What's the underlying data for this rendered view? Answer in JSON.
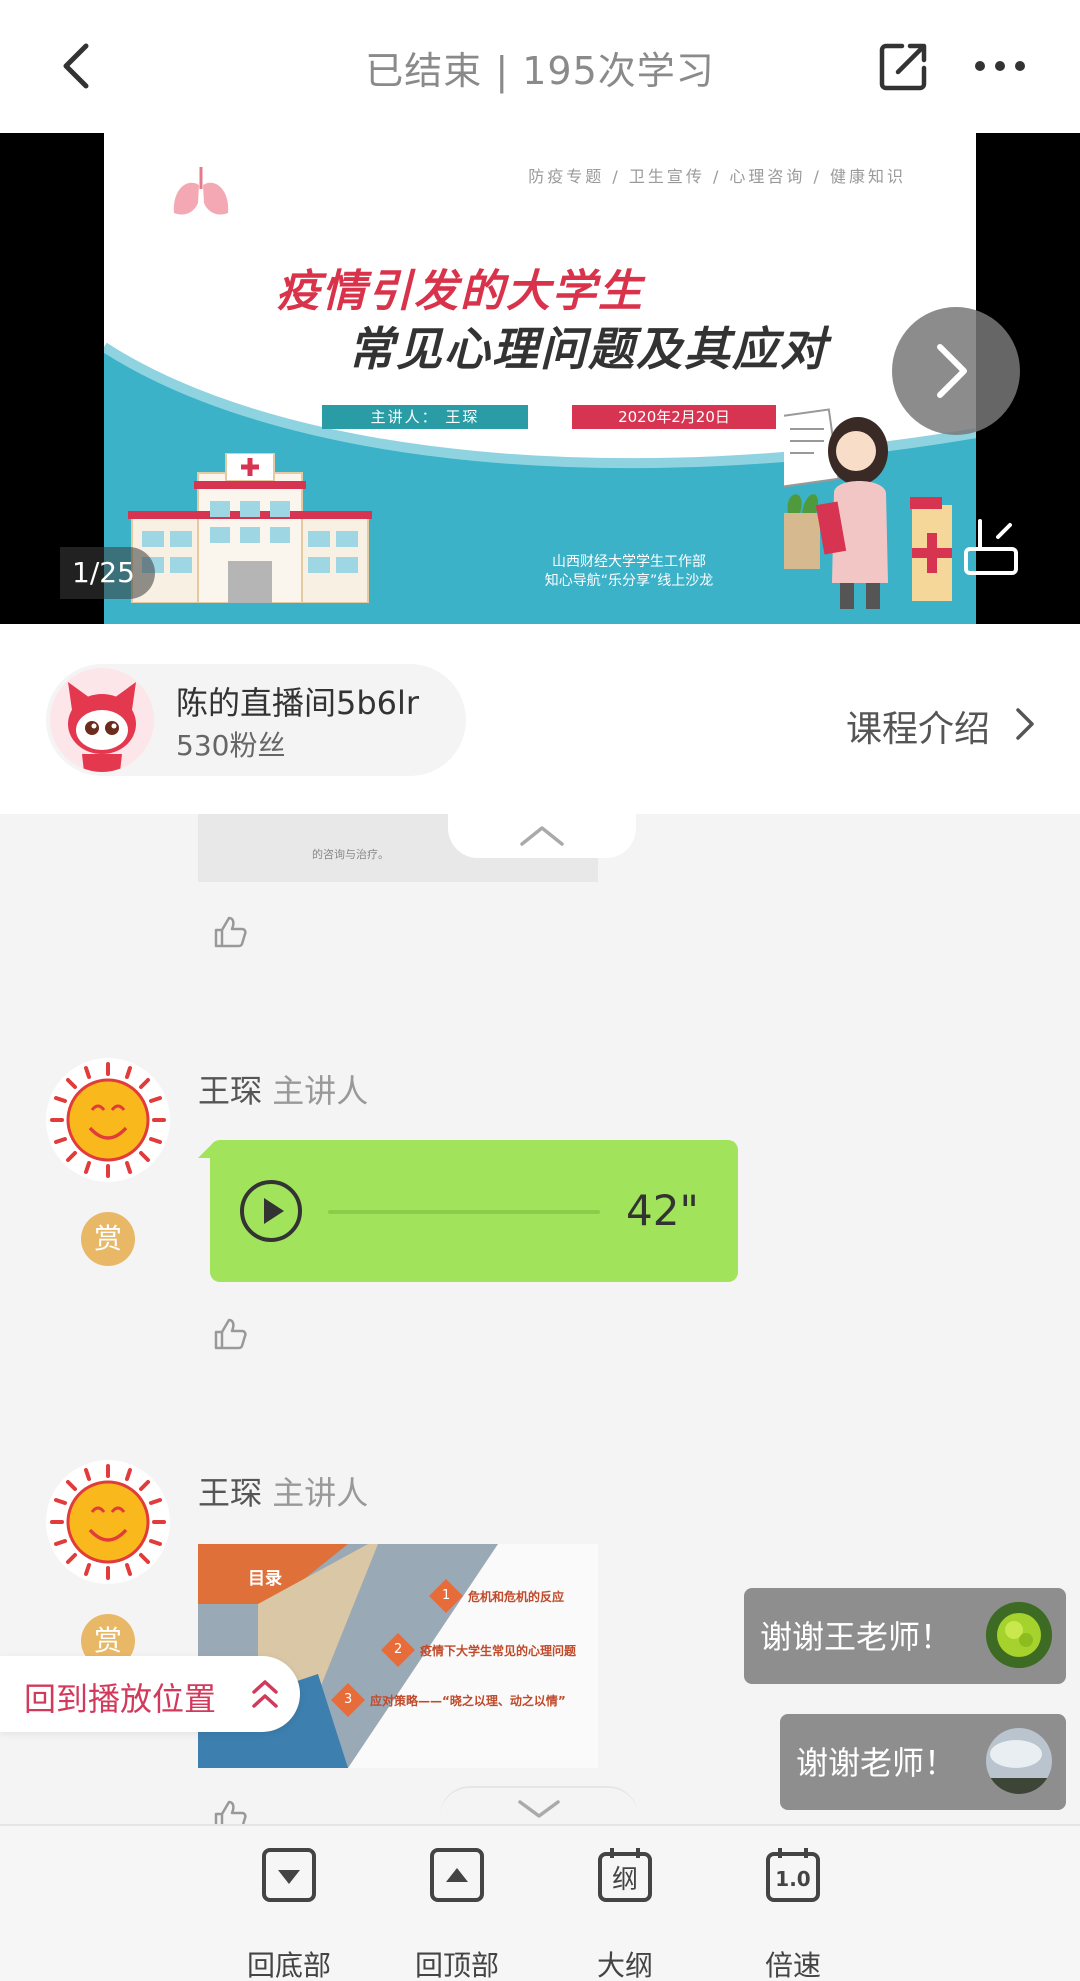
{
  "header": {
    "title": "已结束 | 195次学习"
  },
  "slide": {
    "categories": "防疫专题 / 卫生宣传 / 心理咨询 / 健康知识",
    "title_line1": "疫情引发的大学生",
    "title_line2": "常见心理问题及其应对",
    "speaker": "主讲人： 王琛",
    "date": "2020年2月20日",
    "org_line1": "山西财经大学学生工作部",
    "org_line2": "知心导航“乐分享”线上沙龙",
    "counter": "1/25"
  },
  "host": {
    "name": "陈的直播间5b6lr",
    "fans": "530粉丝",
    "course_intro": "课程介绍"
  },
  "feed": {
    "top_image_caption": "的咨询与治疗。",
    "messages": [
      {
        "author": "王琛",
        "role": "主讲人",
        "reward": "赏",
        "voice_duration": "42\""
      },
      {
        "author": "王琛",
        "role": "主讲人",
        "reward": "赏",
        "thumb_title": "目录",
        "thumb_items": [
          "危机和危机的反应",
          "疫情下大学生常见的心理问题",
          "应对策略——“晓之以理、动之以情”"
        ],
        "thumb_numbers": [
          "1",
          "2",
          "3"
        ]
      }
    ],
    "back_to_position": "回到播放位置",
    "comments": [
      "谢谢王老师！",
      "谢谢老师！"
    ]
  },
  "toolbar": {
    "items": [
      {
        "label": "回底部",
        "icon": "to-bottom-icon"
      },
      {
        "label": "回顶部",
        "icon": "to-top-icon"
      },
      {
        "label": "大纲",
        "icon": "outline-icon",
        "glyph": "纲"
      },
      {
        "label": "倍速",
        "icon": "speed-icon",
        "glyph": "1.0"
      }
    ]
  },
  "colors": {
    "accent_red": "#d23a5c",
    "voice_green": "#a1e45b",
    "reward_gold": "#e9b866",
    "slide_teal": "#3bb2c8"
  }
}
